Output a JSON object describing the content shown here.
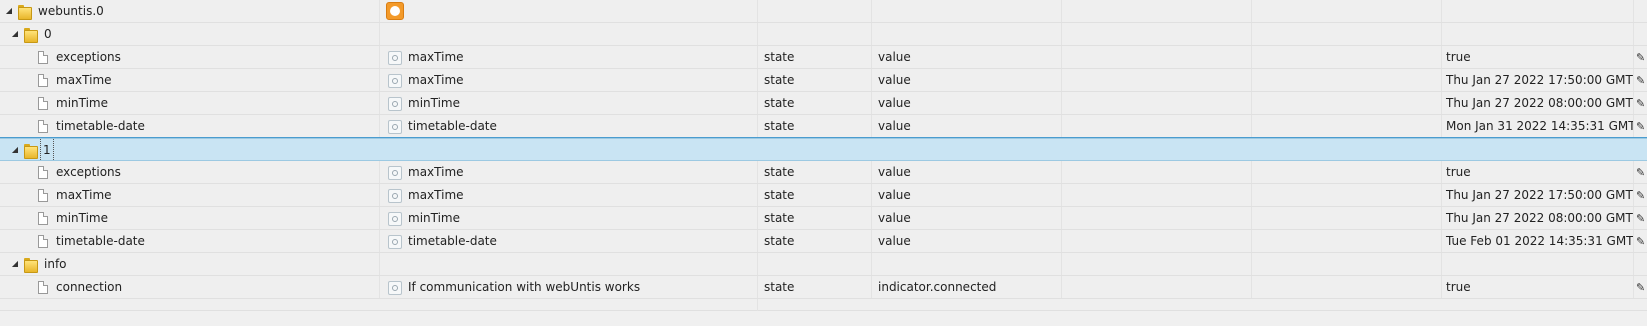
{
  "rows": [
    {
      "name": "webuntis.0"
    },
    {
      "name": "0"
    },
    {
      "name": "exceptions",
      "label": "maxTime",
      "type": "state",
      "role": "value",
      "value": "true"
    },
    {
      "name": "maxTime",
      "label": "maxTime",
      "type": "state",
      "role": "value",
      "value": "Thu Jan 27 2022 17:50:00 GMT+"
    },
    {
      "name": "minTime",
      "label": "minTime",
      "type": "state",
      "role": "value",
      "value": "Thu Jan 27 2022 08:00:00 GMT+"
    },
    {
      "name": "timetable-date",
      "label": "timetable-date",
      "type": "state",
      "role": "value",
      "value": "Mon Jan 31 2022 14:35:31 GMT"
    },
    {
      "name": "1"
    },
    {
      "name": "exceptions",
      "label": "maxTime",
      "type": "state",
      "role": "value",
      "value": "true"
    },
    {
      "name": "maxTime",
      "label": "maxTime",
      "type": "state",
      "role": "value",
      "value": "Thu Jan 27 2022 17:50:00 GMT+"
    },
    {
      "name": "minTime",
      "label": "minTime",
      "type": "state",
      "role": "value",
      "value": "Thu Jan 27 2022 08:00:00 GMT+"
    },
    {
      "name": "timetable-date",
      "label": "timetable-date",
      "type": "state",
      "role": "value",
      "value": "Tue Feb 01 2022 14:35:31 GMT+"
    },
    {
      "name": "info"
    },
    {
      "name": "connection",
      "label": "If communication with webUntis works",
      "type": "state",
      "role": "indicator.connected",
      "value": "true"
    }
  ],
  "icons": {
    "expand": "▲",
    "edit": "✎"
  },
  "colors": {
    "selected_row": "#c9e4f3",
    "adapter_icon": "#f39a2a"
  }
}
